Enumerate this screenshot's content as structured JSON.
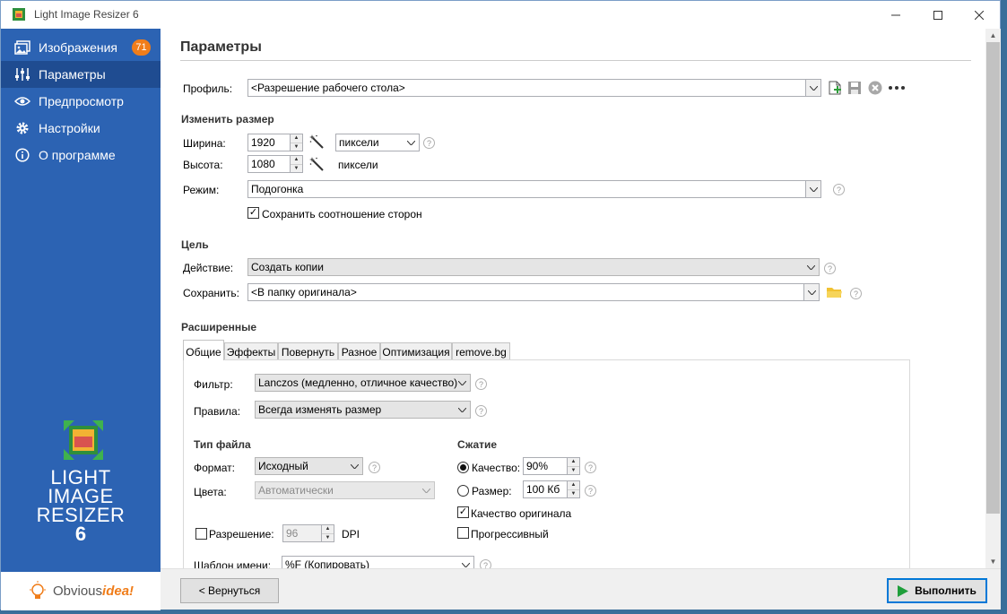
{
  "window": {
    "title": "Light Image Resizer 6",
    "controls": [
      "—",
      "☐",
      "✕"
    ]
  },
  "sidebar": {
    "items": [
      {
        "label": "Изображения",
        "icon": "images-icon",
        "badge": "71"
      },
      {
        "label": "Параметры",
        "icon": "sliders-icon"
      },
      {
        "label": "Предпросмотр",
        "icon": "eye-icon"
      },
      {
        "label": "Настройки",
        "icon": "gear-icon"
      },
      {
        "label": "О программе",
        "icon": "info-icon"
      }
    ],
    "logo": {
      "line1": "LIGHT",
      "line2": "IMAGE",
      "line3": "RESIZER",
      "version": "6"
    },
    "brand": {
      "part1": "Obvious",
      "part2": "idea!"
    }
  },
  "page": {
    "title": "Параметры"
  },
  "profile": {
    "label": "Профиль:",
    "value": "<Разрешение рабочего стола>"
  },
  "resize": {
    "section": "Изменить размер",
    "width_label": "Ширина:",
    "width_value": "1920",
    "height_label": "Высота:",
    "height_value": "1080",
    "unit_value": "пиксели",
    "unit_text": "пиксели",
    "mode_label": "Режим:",
    "mode_value": "Подогонка",
    "keep_ratio_label": "Сохранить соотношение сторон",
    "keep_ratio_checked": true
  },
  "target": {
    "section": "Цель",
    "action_label": "Действие:",
    "action_value": "Создать копии",
    "save_label": "Сохранить:",
    "save_value": "<В папку оригинала>"
  },
  "advanced": {
    "section": "Расширенные",
    "tabs": [
      "Общие",
      "Эффекты",
      "Повернуть",
      "Разное",
      "Оптимизация",
      "remove.bg"
    ],
    "active_tab": "Общие",
    "filter_label": "Фильтр:",
    "filter_value": "Lanczos  (медленно, отличное качество)",
    "rules_label": "Правила:",
    "rules_value": "Всегда изменять размер",
    "filetype_section": "Тип файла",
    "format_label": "Формат:",
    "format_value": "Исходный",
    "colors_label": "Цвета:",
    "colors_value": "Автоматически",
    "resolution_label": "Разрешение:",
    "resolution_value": "96",
    "resolution_unit": "DPI",
    "compression_section": "Сжатие",
    "quality_label": "Качество:",
    "quality_value": "90%",
    "size_label": "Размер:",
    "size_value": "100 Кб",
    "original_quality_label": "Качество оригинала",
    "original_quality_checked": true,
    "progressive_label": "Прогрессивный",
    "progressive_checked": false,
    "name_template_label": "Шаблон имени:",
    "name_template_value": "%F (Копировать)"
  },
  "footer": {
    "back_label": "< Вернуться",
    "run_label": "Выполнить"
  },
  "colors": {
    "sidebar": "#2c63b3",
    "sidebar_active": "#1f4c91",
    "badge": "#f07d1a",
    "accent": "#0078d7",
    "run_icon": "#1e9e3a"
  }
}
